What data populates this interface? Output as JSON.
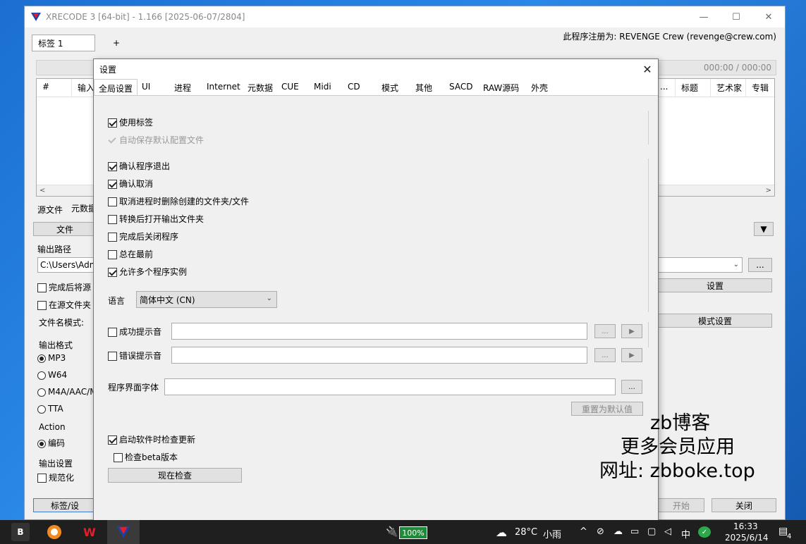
{
  "main_window": {
    "title": "XRECODE 3 [64-bit] - 1.166 [2025-06-07/2804]",
    "registration": "此程序注册为: REVENGE Crew (revenge@crew.com)",
    "tabs": [
      "标签 1",
      "+"
    ],
    "counter": "000:00 / 000:00",
    "columns_left": [
      "#",
      "输入"
    ],
    "columns_right": [
      "...",
      "标题",
      "艺术家",
      "专辑"
    ],
    "source_tabs": [
      "源文件",
      "元数据"
    ],
    "file_button": "文件",
    "output_path_label": "输出路径",
    "output_path_value": "C:\\Users\\Adm",
    "path_browse": "...",
    "check_delete_after": "完成后将源",
    "check_in_source": "在源文件夹",
    "filename_mode_label": "文件名模式:",
    "settings_button": "设置",
    "mode_settings_button": "模式设置",
    "output_format_label": "输出格式",
    "formats": [
      "MP3",
      "W64",
      "M4A/AAC/M",
      "TTA"
    ],
    "action_label": "Action",
    "action_value": "编码",
    "output_settings_label": "输出设置",
    "normalize": "规范化",
    "bottom_btn_left": "标签/设",
    "start_button": "开始",
    "close_button": "关闭"
  },
  "dialog": {
    "title": "设置",
    "tabs": [
      "全局设置",
      "UI",
      "进程",
      "Internet",
      "元数据",
      "CUE",
      "Midi",
      "CD",
      "模式",
      "其他",
      "SACD",
      "RAW源码",
      "外壳"
    ],
    "options": {
      "use_tags": "使用标签",
      "autosave_config": "自动保存默认配置文件",
      "confirm_exit": "确认程序退出",
      "confirm_cancel": "确认取消",
      "delete_on_cancel": "取消进程时删除创建的文件夹/文件",
      "open_output_after": "转换后打开输出文件夹",
      "close_after_done": "完成后关闭程序",
      "always_on_top": "总在最前",
      "allow_multi": "允许多个程序实例"
    },
    "language_label": "语言",
    "language_value": "简体中文 (CN)",
    "success_sound": "成功提示音",
    "error_sound": "错误提示音",
    "browse": "...",
    "play": "▶",
    "font_label": "程序界面字体",
    "reset_default": "重置为默认值",
    "check_update_startup": "启动软件时检查更新",
    "check_beta": "检查beta版本",
    "check_now": "现在检查"
  },
  "watermark": [
    "zb博客",
    "更多会员应用",
    "网址: zbboke.top"
  ],
  "taskbar": {
    "battery": "100%",
    "temperature": "28°C",
    "weather": "小雨",
    "ime": "中",
    "time": "16:33",
    "date": "2025/6/14",
    "notify_count": "4"
  }
}
